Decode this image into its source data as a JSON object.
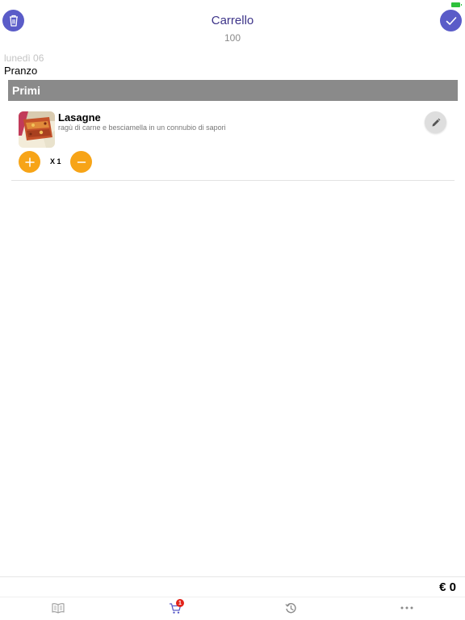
{
  "header": {
    "title": "Carrello",
    "subtitle": "100"
  },
  "day": {
    "date": "lunedì 06",
    "meal": "Pranzo"
  },
  "section": {
    "title": "Primi"
  },
  "items": [
    {
      "name": "Lasagne",
      "description": "ragù di carne e besciamella in un connubio di sapori",
      "quantity": "X 1"
    }
  ],
  "footer": {
    "total": "€ 0"
  },
  "tabbar": {
    "tabs": [
      {
        "icon": "menu-book-icon"
      },
      {
        "icon": "cart-icon",
        "badge": "1"
      },
      {
        "icon": "history-icon"
      },
      {
        "icon": "more-icon"
      }
    ]
  },
  "colors": {
    "accent": "#5a5cc8",
    "title": "#3d3489",
    "quantity_buttons": "#f7a417",
    "section_bg": "#8a8a8a",
    "badge": "#e2231a",
    "battery": "#2ec13c"
  }
}
